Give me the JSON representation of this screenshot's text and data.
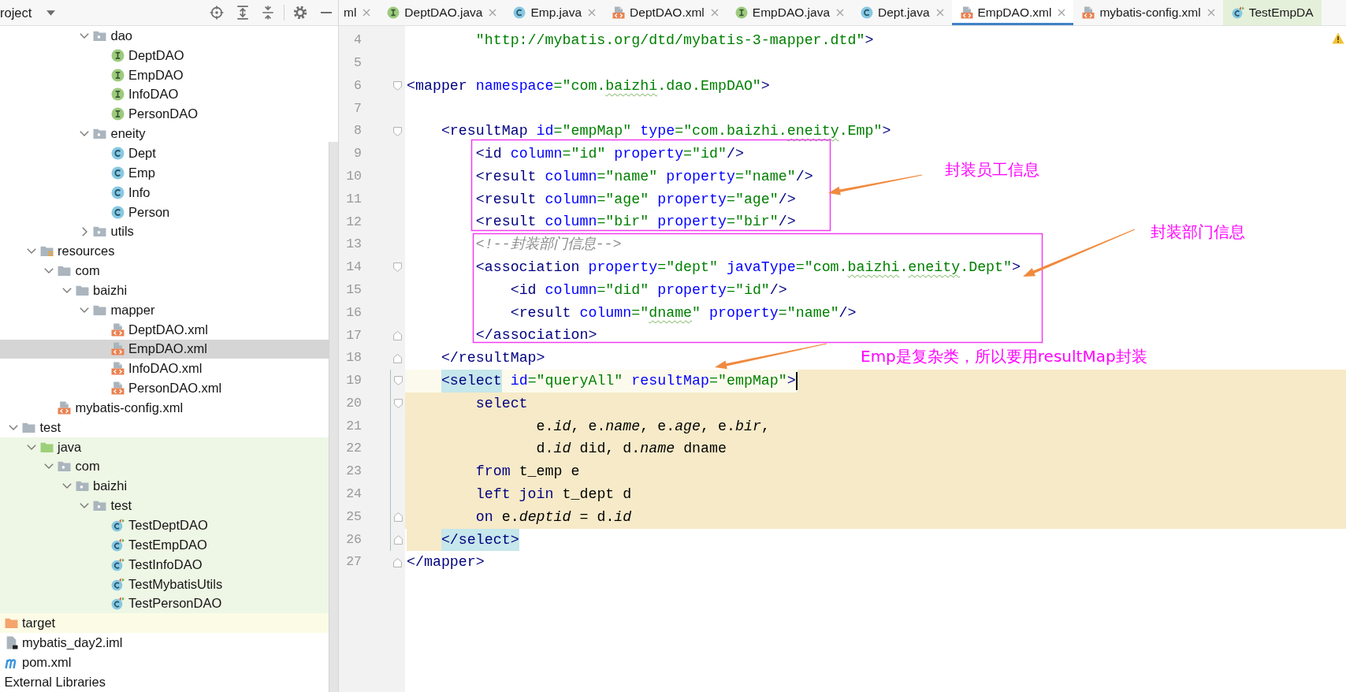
{
  "sidebar": {
    "title": "roject",
    "tree": [
      {
        "children": [
          {
            "children": [
              {
                "children": [
                  {
                    "children": [
                      {
                        "children": [
                          {
                            "children": [
                              {
                                "label": "dao",
                                "kind": "package",
                                "expanded": true,
                                "selected": false,
                                "children": [
                                  {
                                    "label": "DeptDAO",
                                    "kind": "interface",
                                    "selected": false
                                  },
                                  {
                                    "label": "EmpDAO",
                                    "kind": "interface",
                                    "selected": false
                                  },
                                  {
                                    "label": "InfoDAO",
                                    "kind": "interface",
                                    "selected": false
                                  },
                                  {
                                    "label": "PersonDAO",
                                    "kind": "interface",
                                    "selected": false
                                  }
                                ]
                              },
                              {
                                "label": "eneity",
                                "kind": "package",
                                "expanded": true,
                                "selected": false,
                                "children": [
                                  {
                                    "label": "Dept",
                                    "kind": "class",
                                    "selected": false
                                  },
                                  {
                                    "label": "Emp",
                                    "kind": "class",
                                    "selected": false
                                  },
                                  {
                                    "label": "Info",
                                    "kind": "class",
                                    "selected": false
                                  },
                                  {
                                    "label": "Person",
                                    "kind": "class",
                                    "selected": false
                                  }
                                ]
                              },
                              {
                                "label": "utils",
                                "kind": "package",
                                "expanded": false,
                                "selected": false
                              }
                            ]
                          }
                        ]
                      }
                    ]
                  },
                  {
                    "label": "resources",
                    "kind": "resources-folder",
                    "expanded": true,
                    "selected": false,
                    "children": [
                      {
                        "label": "com",
                        "kind": "folder",
                        "expanded": true,
                        "selected": false,
                        "children": [
                          {
                            "label": "baizhi",
                            "kind": "folder",
                            "expanded": true,
                            "selected": false,
                            "children": [
                              {
                                "label": "mapper",
                                "kind": "folder",
                                "expanded": true,
                                "selected": false,
                                "children": [
                                  {
                                    "label": "DeptDAO.xml",
                                    "kind": "xml-file",
                                    "selected": false
                                  },
                                  {
                                    "label": "EmpDAO.xml",
                                    "kind": "xml-file",
                                    "selected": true
                                  },
                                  {
                                    "label": "InfoDAO.xml",
                                    "kind": "xml-file",
                                    "selected": false
                                  },
                                  {
                                    "label": "PersonDAO.xml",
                                    "kind": "xml-file",
                                    "selected": false
                                  }
                                ]
                              }
                            ]
                          }
                        ]
                      },
                      {
                        "label": "mybatis-config.xml",
                        "kind": "xml-file",
                        "selected": false
                      }
                    ]
                  }
                ]
              },
              {
                "label": "test",
                "kind": "folder",
                "expanded": true,
                "selected": false,
                "children": [
                  {
                    "label": "java",
                    "kind": "test-source-folder",
                    "test_sources": true,
                    "expanded": true,
                    "selected": false,
                    "children": [
                      {
                        "label": "com",
                        "kind": "package",
                        "expanded": true,
                        "selected": false,
                        "children": [
                          {
                            "label": "baizhi",
                            "kind": "package",
                            "expanded": true,
                            "selected": false,
                            "children": [
                              {
                                "label": "test",
                                "kind": "package",
                                "expanded": true,
                                "selected": false,
                                "children": [
                                  {
                                    "label": "TestDeptDAO",
                                    "kind": "test-class",
                                    "selected": false
                                  },
                                  {
                                    "label": "TestEmpDAO",
                                    "kind": "test-class",
                                    "selected": false
                                  },
                                  {
                                    "label": "TestInfoDAO",
                                    "kind": "test-class",
                                    "selected": false
                                  },
                                  {
                                    "label": "TestMybatisUtils",
                                    "kind": "test-class",
                                    "selected": false
                                  },
                                  {
                                    "label": "TestPersonDAO",
                                    "kind": "test-class",
                                    "selected": false
                                  }
                                ]
                              }
                            ]
                          }
                        ]
                      }
                    ]
                  }
                ]
              }
            ]
          },
          {
            "label": "target",
            "kind": "excluded-folder",
            "excluded": true,
            "selected": false
          },
          {
            "label": "mybatis_day2.iml",
            "kind": "module-file",
            "selected": false
          },
          {
            "label": "pom.xml",
            "kind": "maven-file",
            "selected": false
          }
        ]
      },
      {
        "label": "External Libraries",
        "selected": false
      }
    ]
  },
  "tabs": [
    {
      "label": "ml",
      "selected": false,
      "closable": true
    },
    {
      "label": "DeptDAO.java",
      "kind": "interface",
      "selected": false,
      "closable": true
    },
    {
      "label": "Emp.java",
      "kind": "class",
      "selected": false,
      "closable": true
    },
    {
      "label": "DeptDAO.xml",
      "kind": "xml-file",
      "selected": false,
      "closable": true
    },
    {
      "label": "EmpDAO.java",
      "kind": "interface",
      "selected": false,
      "closable": true
    },
    {
      "label": "Dept.java",
      "kind": "class",
      "selected": false,
      "closable": true
    },
    {
      "label": "EmpDAO.xml",
      "kind": "xml-file",
      "selected": true,
      "closable": true
    },
    {
      "label": "mybatis-config.xml",
      "kind": "xml-file",
      "selected": false,
      "closable": true
    },
    {
      "label": "TestEmpDA",
      "kind": "test-class",
      "test_file": true,
      "selected": false,
      "closable": false
    }
  ],
  "editor": {
    "lines": [
      {
        "number": "4",
        "current": false,
        "tokens": [
          {
            "kind": "value",
            "text": "        \"http://mybatis.org/dtd/mybatis-3-mapper.dtd\""
          },
          {
            "kind": "tag",
            "text": ">"
          }
        ]
      },
      {
        "number": "5",
        "current": false
      },
      {
        "number": "6",
        "current": false,
        "fold_open": true,
        "tokens": [
          {
            "kind": "tag",
            "text": "<mapper"
          },
          {
            "kind": "attr",
            "text": " namespace"
          },
          {
            "kind": "value",
            "text": "=\"com."
          },
          {
            "kind": "typo",
            "text": "baizhi"
          },
          {
            "kind": "value",
            "text": ".dao.EmpDAO\""
          },
          {
            "kind": "tag",
            "text": ">"
          }
        ]
      },
      {
        "number": "7",
        "current": false
      },
      {
        "number": "8",
        "current": false,
        "fold_open": true,
        "tokens": [
          {
            "kind": "tag",
            "text": "    <resultMap"
          },
          {
            "kind": "attr",
            "text": " id"
          },
          {
            "kind": "value",
            "text": "=\"empMap\""
          },
          {
            "kind": "attr",
            "text": " type"
          },
          {
            "kind": "value",
            "text": "=\"com.baizhi."
          },
          {
            "kind": "typo",
            "text": "eneity"
          },
          {
            "kind": "value",
            "text": ".Emp\""
          },
          {
            "kind": "tag",
            "text": ">"
          }
        ]
      },
      {
        "number": "9",
        "current": false,
        "tokens": [
          {
            "kind": "tag",
            "text": "        <id"
          },
          {
            "kind": "attr",
            "text": " column"
          },
          {
            "kind": "value",
            "text": "=\"id\""
          },
          {
            "kind": "attr",
            "text": " property"
          },
          {
            "kind": "value",
            "text": "=\"id\""
          },
          {
            "kind": "tag",
            "text": "/>"
          }
        ]
      },
      {
        "number": "10",
        "current": false,
        "tokens": [
          {
            "kind": "tag",
            "text": "        <result"
          },
          {
            "kind": "attr",
            "text": " column"
          },
          {
            "kind": "value",
            "text": "=\"name\""
          },
          {
            "kind": "attr",
            "text": " property"
          },
          {
            "kind": "value",
            "text": "=\"name\""
          },
          {
            "kind": "tag",
            "text": "/>"
          }
        ]
      },
      {
        "number": "11",
        "current": false,
        "tokens": [
          {
            "kind": "tag",
            "text": "        <result"
          },
          {
            "kind": "attr",
            "text": " column"
          },
          {
            "kind": "value",
            "text": "=\"age\""
          },
          {
            "kind": "attr",
            "text": " property"
          },
          {
            "kind": "value",
            "text": "=\"age\""
          },
          {
            "kind": "tag",
            "text": "/>"
          }
        ]
      },
      {
        "number": "12",
        "current": false,
        "tokens": [
          {
            "kind": "tag",
            "text": "        <result"
          },
          {
            "kind": "attr",
            "text": " column"
          },
          {
            "kind": "value",
            "text": "=\"bir\""
          },
          {
            "kind": "attr",
            "text": " property"
          },
          {
            "kind": "value",
            "text": "=\"bir\""
          },
          {
            "kind": "tag",
            "text": "/>"
          }
        ]
      },
      {
        "number": "13",
        "current": false,
        "tokens": [
          {
            "kind": "comment",
            "text": "        <!--封装部门信息-->"
          }
        ]
      },
      {
        "number": "14",
        "current": false,
        "fold_open": true,
        "tokens": [
          {
            "kind": "tag",
            "text": "        <association"
          },
          {
            "kind": "attr",
            "text": " property"
          },
          {
            "kind": "value",
            "text": "=\"dept\""
          },
          {
            "kind": "attr",
            "text": " javaType"
          },
          {
            "kind": "value",
            "text": "=\"com."
          },
          {
            "kind": "typo",
            "text": "baizhi"
          },
          {
            "kind": "value",
            "text": "."
          },
          {
            "kind": "typo",
            "text": "eneity"
          },
          {
            "kind": "value",
            "text": ".Dept\""
          },
          {
            "kind": "tag",
            "text": ">"
          }
        ]
      },
      {
        "number": "15",
        "current": false,
        "tokens": [
          {
            "kind": "tag",
            "text": "            <id"
          },
          {
            "kind": "attr",
            "text": " column"
          },
          {
            "kind": "value",
            "text": "=\"did\""
          },
          {
            "kind": "attr",
            "text": " property"
          },
          {
            "kind": "value",
            "text": "=\"id\""
          },
          {
            "kind": "tag",
            "text": "/>"
          }
        ]
      },
      {
        "number": "16",
        "current": false,
        "tokens": [
          {
            "kind": "tag",
            "text": "            <result"
          },
          {
            "kind": "attr",
            "text": " column"
          },
          {
            "kind": "value",
            "text": "=\""
          },
          {
            "kind": "typo",
            "text": "dname"
          },
          {
            "kind": "value",
            "text": "\""
          },
          {
            "kind": "attr",
            "text": " property"
          },
          {
            "kind": "value",
            "text": "=\"name\""
          },
          {
            "kind": "tag",
            "text": "/>"
          }
        ]
      },
      {
        "number": "17",
        "current": false,
        "fold_close": true,
        "tokens": [
          {
            "kind": "tag",
            "text": "        </association>"
          }
        ]
      },
      {
        "number": "18",
        "current": false,
        "fold_close": true,
        "tokens": [
          {
            "kind": "tag",
            "text": "    </resultMap>"
          }
        ]
      },
      {
        "number": "19",
        "current": true,
        "fold_open": true,
        "injection_start": true,
        "tokens": [
          {
            "kind": "match",
            "text": "    <select"
          },
          {
            "kind": "attr",
            "text": " id"
          },
          {
            "kind": "value",
            "text": "=\"queryAll\""
          },
          {
            "kind": "attr",
            "text": " resultMap"
          },
          {
            "kind": "value",
            "text": "=\"empMap\""
          },
          {
            "kind": "tag",
            "text": ">"
          }
        ]
      },
      {
        "number": "20",
        "current": false,
        "fold_open": true,
        "injected": true,
        "tokens": [
          {
            "kind": "keyword",
            "text": "        select"
          }
        ]
      },
      {
        "number": "21",
        "current": false,
        "injected": true,
        "tokens": [
          {
            "kind": "plain",
            "text": "               e."
          },
          {
            "kind": "column",
            "text": "id"
          },
          {
            "kind": "plain",
            "text": ", e."
          },
          {
            "kind": "column",
            "text": "name"
          },
          {
            "kind": "plain",
            "text": ", e."
          },
          {
            "kind": "column",
            "text": "age"
          },
          {
            "kind": "plain",
            "text": ", e."
          },
          {
            "kind": "column",
            "text": "bir"
          },
          {
            "kind": "plain",
            "text": ","
          }
        ]
      },
      {
        "number": "22",
        "current": false,
        "injected": true,
        "tokens": [
          {
            "kind": "plain",
            "text": "               d."
          },
          {
            "kind": "column",
            "text": "id"
          },
          {
            "kind": "plain",
            "text": " did, d."
          },
          {
            "kind": "column",
            "text": "name"
          },
          {
            "kind": "plain",
            "text": " dname"
          }
        ]
      },
      {
        "number": "23",
        "current": false,
        "injected": true,
        "tokens": [
          {
            "kind": "keyword",
            "text": "        from"
          },
          {
            "kind": "plain",
            "text": " t_emp e"
          }
        ]
      },
      {
        "number": "24",
        "current": false,
        "injected": true,
        "tokens": [
          {
            "kind": "keyword",
            "text": "        left join"
          },
          {
            "kind": "plain",
            "text": " t_dept d"
          }
        ]
      },
      {
        "number": "25",
        "current": false,
        "fold_close": true,
        "injected": true,
        "tokens": [
          {
            "kind": "keyword",
            "text": "        on"
          },
          {
            "kind": "plain",
            "text": " e."
          },
          {
            "kind": "column",
            "text": "deptid"
          },
          {
            "kind": "plain",
            "text": " = d."
          },
          {
            "kind": "column",
            "text": "id"
          }
        ]
      },
      {
        "number": "26",
        "current": false,
        "fold_close": true,
        "injection_end": true,
        "tokens": [
          {
            "kind": "match",
            "text": "    </select>"
          }
        ]
      },
      {
        "number": "27",
        "current": false,
        "fold_close": true,
        "tokens": [
          {
            "kind": "tag",
            "text": "</mapper>"
          }
        ]
      }
    ]
  },
  "annotations": [
    {
      "text": "封装员工信息"
    },
    {
      "text": "封装部门信息"
    },
    {
      "text": "Emp是复杂类，所以要用resultMap封装"
    }
  ]
}
